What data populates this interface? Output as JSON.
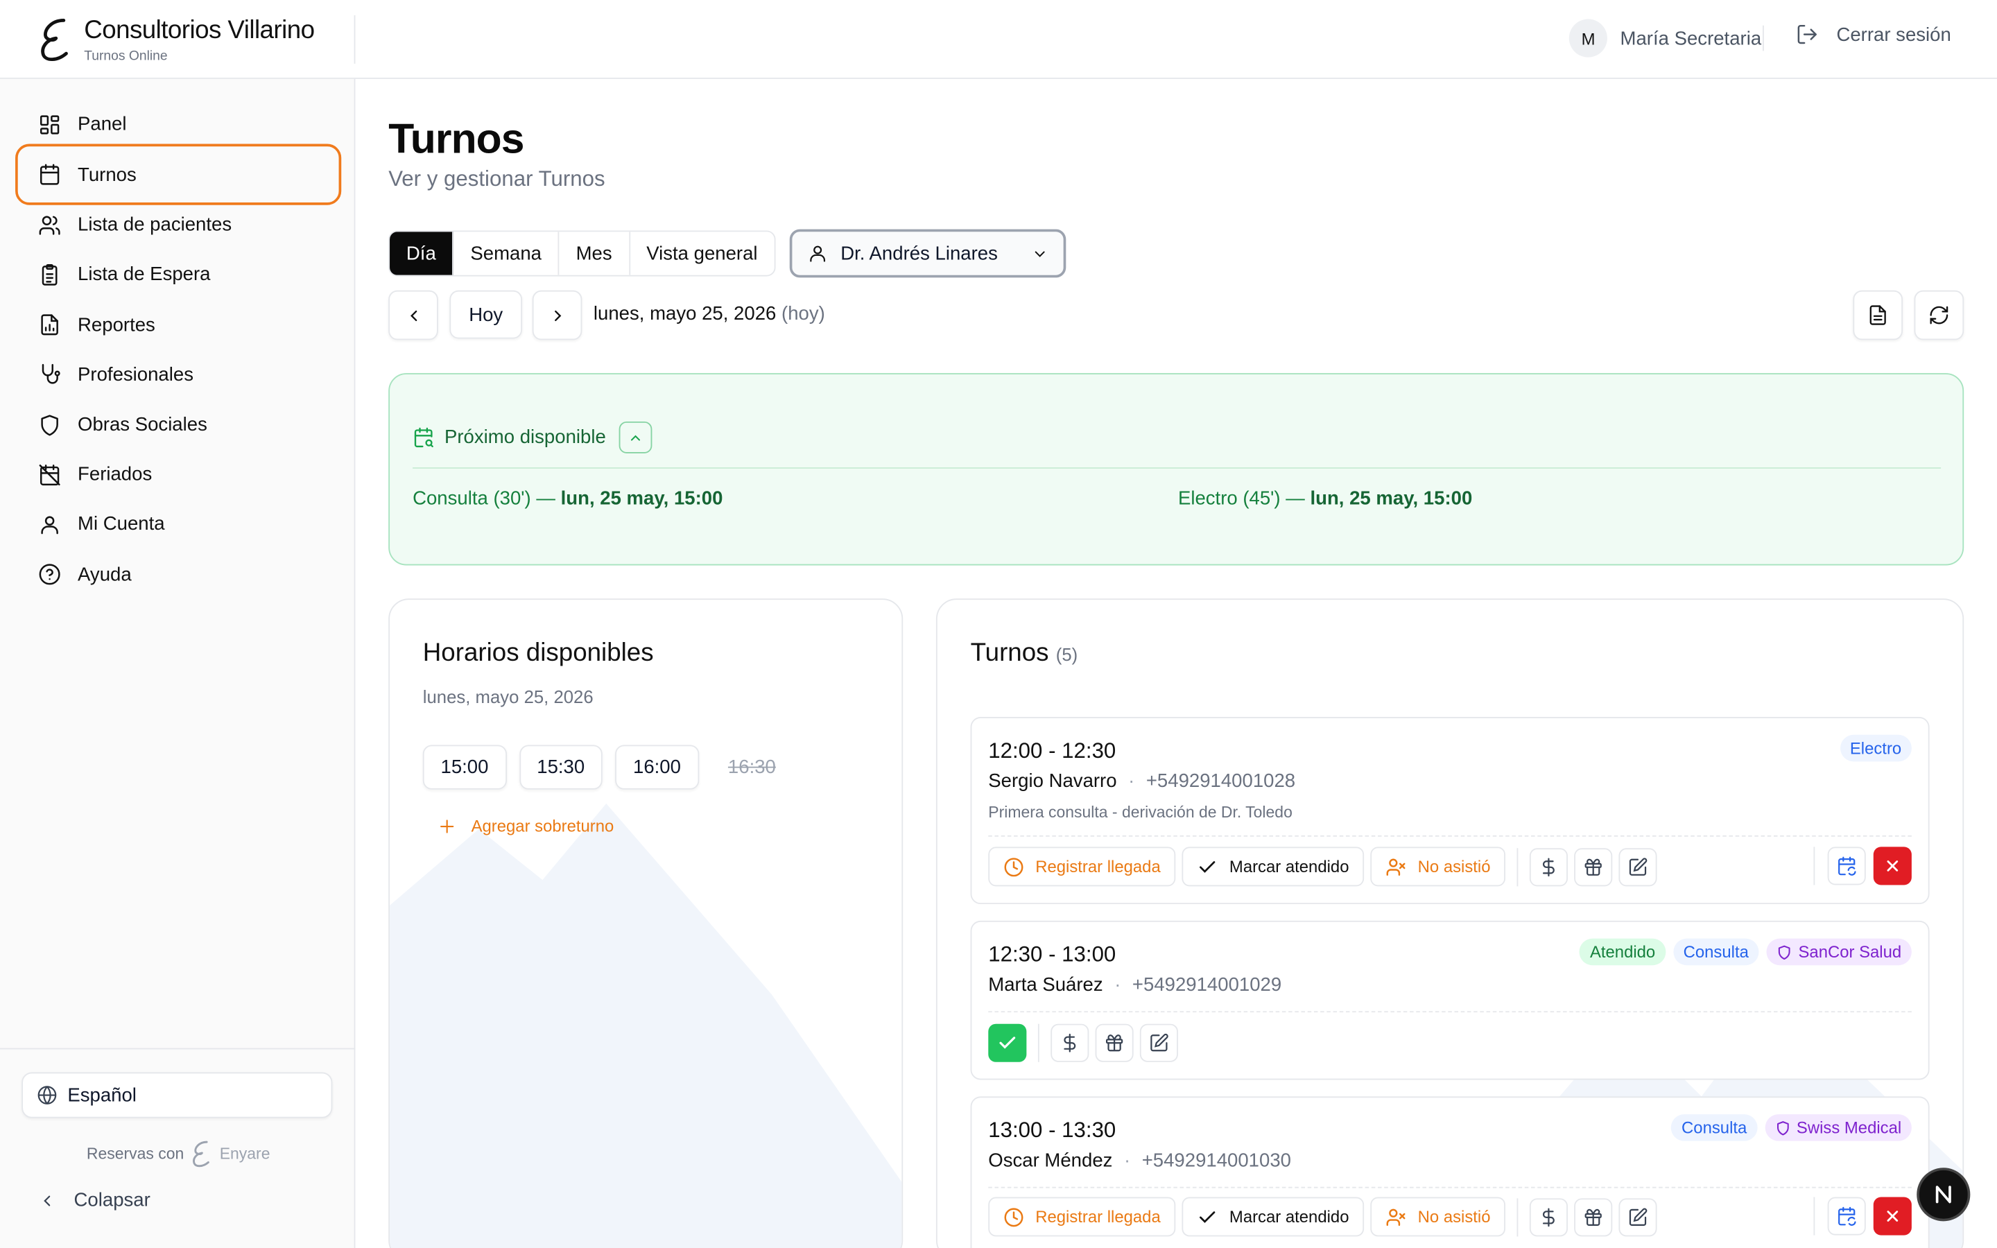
{
  "app": {
    "title": "Consultorios Villarino",
    "subtitle": "Turnos Online"
  },
  "header": {
    "user_initial": "M",
    "user_name": "María Secretaria",
    "logout_label": "Cerrar sesión"
  },
  "sidebar": {
    "items": [
      {
        "label": "Panel",
        "icon": "grid-icon"
      },
      {
        "label": "Turnos",
        "icon": "calendar-icon",
        "active": true
      },
      {
        "label": "Lista de pacientes",
        "icon": "users-icon"
      },
      {
        "label": "Lista de Espera",
        "icon": "clipboard-icon"
      },
      {
        "label": "Reportes",
        "icon": "report-icon"
      },
      {
        "label": "Profesionales",
        "icon": "stethoscope-icon"
      },
      {
        "label": "Obras Sociales",
        "icon": "shield-icon"
      },
      {
        "label": "Feriados",
        "icon": "calendar-off-icon"
      },
      {
        "label": "Mi Cuenta",
        "icon": "user-icon"
      },
      {
        "label": "Ayuda",
        "icon": "help-icon"
      }
    ],
    "language": "Español",
    "powered_prefix": "Reservas con",
    "powered_brand": "Enyare",
    "collapse_label": "Colapsar"
  },
  "page": {
    "title": "Turnos",
    "subtitle": "Ver y gestionar Turnos"
  },
  "views": {
    "tabs": [
      "Día",
      "Semana",
      "Mes",
      "Vista general"
    ],
    "selected": "Día"
  },
  "doctor_select": {
    "value": "Dr. Andrés Linares"
  },
  "date_nav": {
    "today_label": "Hoy",
    "date": "lunes, mayo 25, 2026",
    "suffix": "(hoy)"
  },
  "next_available": {
    "title": "Próximo disponible",
    "items": [
      {
        "service": "Consulta (30')",
        "when": "lun, 25 may, 15:00"
      },
      {
        "service": "Electro (45')",
        "when": "lun, 25 may, 15:00"
      }
    ]
  },
  "available": {
    "title": "Horarios disponibles",
    "date": "lunes, mayo 25, 2026",
    "slots": [
      {
        "time": "15:00",
        "available": true
      },
      {
        "time": "15:30",
        "available": true
      },
      {
        "time": "16:00",
        "available": true
      },
      {
        "time": "16:30",
        "available": false
      }
    ],
    "add_label": "Agregar sobreturno"
  },
  "appointments": {
    "title": "Turnos",
    "count": "(5)",
    "actions": {
      "arrive": "Registrar llegada",
      "attended": "Marcar atendido",
      "noshow": "No asistió"
    },
    "items": [
      {
        "time": "12:00 - 12:30",
        "name": "Sergio Navarro",
        "phone": "+5492914001028",
        "note": "Primera consulta - derivación de Dr. Toledo",
        "badges": [
          {
            "text": "Electro",
            "kind": "blue"
          }
        ],
        "status": "pending"
      },
      {
        "time": "12:30 - 13:00",
        "name": "Marta Suárez",
        "phone": "+5492914001029",
        "note": "",
        "badges": [
          {
            "text": "Atendido",
            "kind": "green"
          },
          {
            "text": "Consulta",
            "kind": "blue"
          },
          {
            "text": "SanCor Salud",
            "kind": "purple"
          }
        ],
        "status": "attended"
      },
      {
        "time": "13:00 - 13:30",
        "name": "Oscar Méndez",
        "phone": "+5492914001030",
        "note": "",
        "badges": [
          {
            "text": "Consulta",
            "kind": "blue"
          },
          {
            "text": "Swiss Medical",
            "kind": "purple"
          }
        ],
        "status": "pending"
      }
    ]
  },
  "colors": {
    "accent": "#0b0b0b",
    "active_outline": "#f07b1d",
    "success": "#22c55e",
    "danger": "#e11d24",
    "orange_text": "#ea7a14"
  }
}
